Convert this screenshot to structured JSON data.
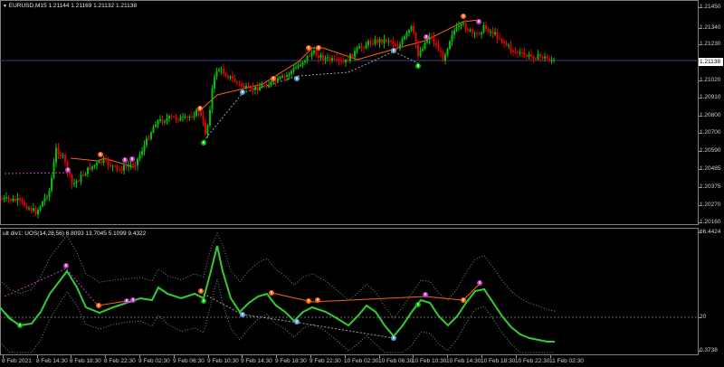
{
  "chart_header": {
    "arrow": "▼",
    "symbol": "EURUSD,M15",
    "ohlc": "1.21144 1.21169 1.21132 1.21138"
  },
  "indicator_header": {
    "text": "ult div1: UOS(14,28,56) 6.8093 13.7045 5.1099 9.4322"
  },
  "price_axis": [
    "1.21450",
    "1.21340",
    "1.21230",
    "1.21130",
    "1.21020",
    "1.20910",
    "1.20800",
    "1.20700",
    "1.20590",
    "1.20485",
    "1.20375",
    "1.20270",
    "1.20160"
  ],
  "current_price": "1.21138",
  "indicator_axis": [
    "66.4424",
    "20",
    "0.3738"
  ],
  "time_axis": [
    "8 Feb 2021",
    "8 Feb 14:30",
    "8 Feb 18:30",
    "8 Feb 22:30",
    "9 Feb 02:30",
    "9 Feb 06:30",
    "9 Feb 10:30",
    "9 Feb 14:30",
    "9 Feb 18:30",
    "9 Feb 22:30",
    "10 Feb 02:30",
    "10 Feb 06:30",
    "10 Feb 10:30",
    "10 Feb 14:30",
    "10 Feb 18:30",
    "10 Feb 22:30",
    "11 Feb 02:30"
  ],
  "colors": {
    "background": "#000000",
    "bull": "#00c000",
    "bear": "#e00000",
    "uos_line": "#33cc33",
    "bands": "#808080",
    "bull_div_marker": "#5aa0d0",
    "bear_div_marker": "#c040c0",
    "signal_orange": "#ff6010",
    "current_price_line": "#3c3c96"
  },
  "icons": {
    "bearish_divergence": "arrow-up-marker-icon",
    "bullish_divergence": "arrow-down-marker-icon"
  }
}
